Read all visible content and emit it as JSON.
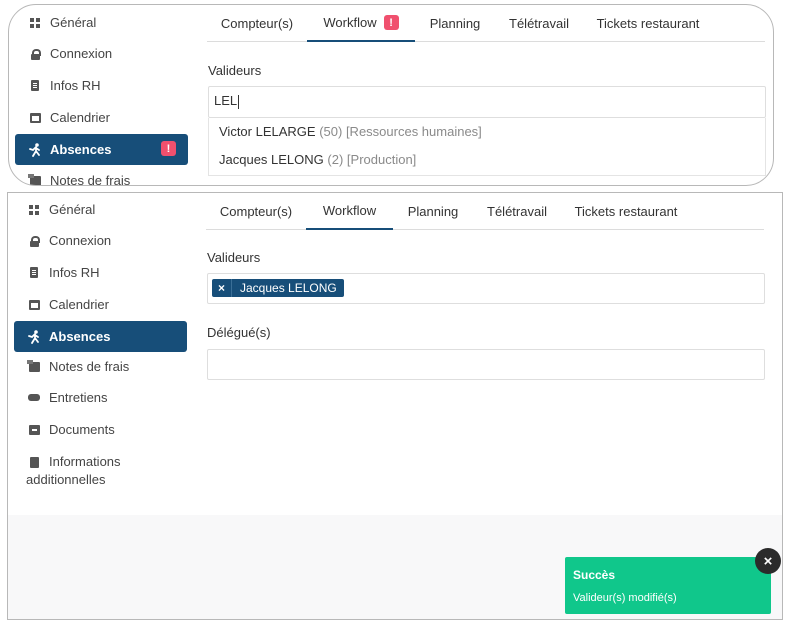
{
  "top": {
    "sidebar": [
      {
        "label": "Général",
        "icon": "dashboard-icon"
      },
      {
        "label": "Connexion",
        "icon": "lock-icon"
      },
      {
        "label": "Infos RH",
        "icon": "badge-icon"
      },
      {
        "label": "Calendrier",
        "icon": "calendar-icon"
      },
      {
        "label": "Absences",
        "icon": "running-icon",
        "alert": "!"
      },
      {
        "label": "Notes de frais",
        "icon": "receipt-icon"
      }
    ],
    "tabs": [
      {
        "label": "Compteur(s)"
      },
      {
        "label": "Workflow",
        "alert": "!"
      },
      {
        "label": "Planning"
      },
      {
        "label": "Télétravail"
      },
      {
        "label": "Tickets restaurant"
      }
    ],
    "validators_label": "Valideurs",
    "search_value": "LEL",
    "suggestions": [
      {
        "name": "Victor LELARGE",
        "meta": "(50) [Ressources humaines]"
      },
      {
        "name": "Jacques LELONG",
        "meta": "(2) [Production]"
      }
    ]
  },
  "bottom": {
    "sidebar": [
      {
        "label": "Général",
        "icon": "dashboard-icon"
      },
      {
        "label": "Connexion",
        "icon": "lock-icon"
      },
      {
        "label": "Infos RH",
        "icon": "badge-icon"
      },
      {
        "label": "Calendrier",
        "icon": "calendar-icon"
      },
      {
        "label": "Absences",
        "icon": "running-icon"
      },
      {
        "label": "Notes de frais",
        "icon": "receipt-icon"
      },
      {
        "label": "Entretiens",
        "icon": "handshake-icon"
      },
      {
        "label": "Documents",
        "icon": "archive-icon"
      },
      {
        "label": "Informations additionnelles",
        "line1": "Informations",
        "line2": "additionnelles",
        "icon": "book-icon"
      }
    ],
    "tabs": [
      {
        "label": "Compteur(s)"
      },
      {
        "label": "Workflow"
      },
      {
        "label": "Planning"
      },
      {
        "label": "Télétravail"
      },
      {
        "label": "Tickets restaurant"
      }
    ],
    "validators_label": "Valideurs",
    "validator_token": {
      "remove": "×",
      "name": "Jacques LELONG"
    },
    "delegates_label": "Délégué(s)",
    "toast": {
      "title": "Succès",
      "message": "Valideur(s) modifié(s)",
      "close": "×"
    }
  },
  "colors": {
    "accent": "#174e79",
    "alert": "#f0506e",
    "success": "#10c78b"
  }
}
